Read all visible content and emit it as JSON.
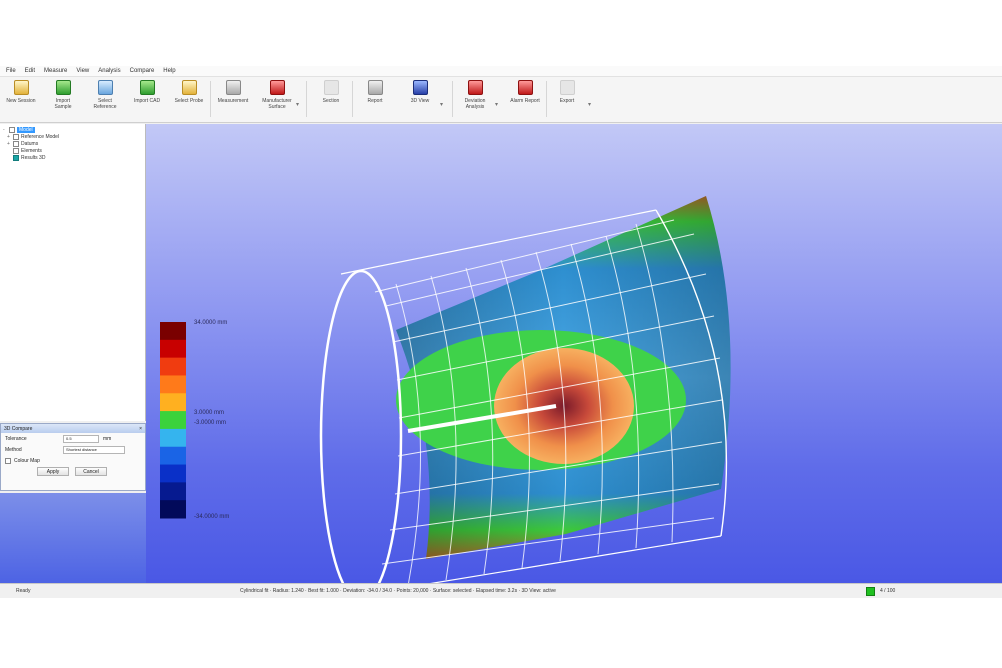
{
  "menu": [
    "File",
    "Edit",
    "Measure",
    "View",
    "Analysis",
    "Compare",
    "Help"
  ],
  "toolbar": {
    "buttons": [
      {
        "label": "New Session",
        "icon": "new-session-icon"
      },
      {
        "label": "Import Sample",
        "icon": "import-sample-icon"
      },
      {
        "label": "Select Reference",
        "icon": "select-reference-icon"
      },
      {
        "label": "Import CAD",
        "icon": "import-cad-icon"
      },
      {
        "label": "Select Probe",
        "icon": "select-probe-icon"
      },
      {
        "label": "Measurement",
        "icon": "measurement-icon"
      },
      {
        "label": "Manufacturer Surface",
        "icon": "surface-icon"
      },
      {
        "label": "Section",
        "icon": "section-icon"
      },
      {
        "label": "Report",
        "icon": "report-icon"
      },
      {
        "label": "3D View",
        "icon": "3d-view-icon"
      },
      {
        "label": "Deviation Analysis",
        "icon": "deviation-analysis-icon"
      },
      {
        "label": "Alarm Report",
        "icon": "alarm-report-icon"
      },
      {
        "label": "Export",
        "icon": "export-icon"
      }
    ]
  },
  "tree": {
    "items": [
      {
        "label": "Model",
        "expander": "-",
        "selected": true,
        "teal": false
      },
      {
        "label": "Reference Model",
        "expander": "+",
        "selected": false,
        "teal": false
      },
      {
        "label": "Datums",
        "expander": "+",
        "selected": false,
        "teal": false
      },
      {
        "label": "Elements",
        "expander": "",
        "selected": false,
        "teal": false
      },
      {
        "label": "Results 3D",
        "expander": "",
        "selected": false,
        "teal": true
      }
    ]
  },
  "properties": {
    "title": "3D Compare",
    "close": "×",
    "row1_label": "Tolerance",
    "row1_value": "0.5",
    "row1_unit": "mm",
    "row2_label": "Method",
    "row2_value": "Shortest distance",
    "checkbox_label": "Colour Map",
    "apply_label": "Apply",
    "cancel_label": "Cancel"
  },
  "legend": {
    "max_label": "34.0000 mm",
    "upper_mid_label": "3.0000 mm",
    "lower_mid_label": "-3.0000 mm",
    "min_label": "-34.0000 mm",
    "colors": [
      "#7a0000",
      "#c80000",
      "#f03c10",
      "#ff7a1a",
      "#ffb020",
      "#3bd23b",
      "#35b4ee",
      "#1a64e6",
      "#0a30c8",
      "#061a90",
      "#020a5a"
    ]
  },
  "status": {
    "left": "Ready",
    "middle": "Cylindrical fit · Radius: 1.240 · Best fit: 1.000 · Deviation: -34.0 / 34.0 · Points: 20,000 · Surface: selected · Elapsed time: 3.2s · 3D View: active",
    "right": "4 / 100"
  },
  "colors": {
    "viewport_top": "#c2c8f6",
    "viewport_bottom": "#4a58e5",
    "selection": "#3399ff"
  }
}
